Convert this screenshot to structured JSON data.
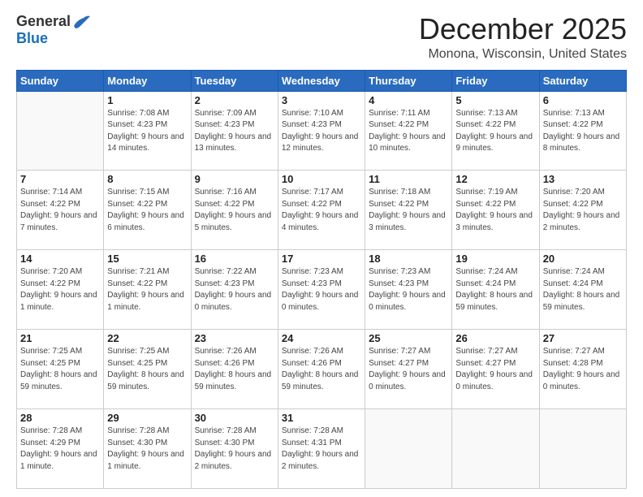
{
  "header": {
    "logo_general": "General",
    "logo_blue": "Blue",
    "title": "December 2025",
    "location": "Monona, Wisconsin, United States"
  },
  "days_of_week": [
    "Sunday",
    "Monday",
    "Tuesday",
    "Wednesday",
    "Thursday",
    "Friday",
    "Saturday"
  ],
  "weeks": [
    [
      {
        "day": "",
        "detail": ""
      },
      {
        "day": "1",
        "detail": "Sunrise: 7:08 AM\nSunset: 4:23 PM\nDaylight: 9 hours\nand 14 minutes."
      },
      {
        "day": "2",
        "detail": "Sunrise: 7:09 AM\nSunset: 4:23 PM\nDaylight: 9 hours\nand 13 minutes."
      },
      {
        "day": "3",
        "detail": "Sunrise: 7:10 AM\nSunset: 4:23 PM\nDaylight: 9 hours\nand 12 minutes."
      },
      {
        "day": "4",
        "detail": "Sunrise: 7:11 AM\nSunset: 4:22 PM\nDaylight: 9 hours\nand 10 minutes."
      },
      {
        "day": "5",
        "detail": "Sunrise: 7:13 AM\nSunset: 4:22 PM\nDaylight: 9 hours\nand 9 minutes."
      },
      {
        "day": "6",
        "detail": "Sunrise: 7:13 AM\nSunset: 4:22 PM\nDaylight: 9 hours\nand 8 minutes."
      }
    ],
    [
      {
        "day": "7",
        "detail": "Sunrise: 7:14 AM\nSunset: 4:22 PM\nDaylight: 9 hours\nand 7 minutes."
      },
      {
        "day": "8",
        "detail": "Sunrise: 7:15 AM\nSunset: 4:22 PM\nDaylight: 9 hours\nand 6 minutes."
      },
      {
        "day": "9",
        "detail": "Sunrise: 7:16 AM\nSunset: 4:22 PM\nDaylight: 9 hours\nand 5 minutes."
      },
      {
        "day": "10",
        "detail": "Sunrise: 7:17 AM\nSunset: 4:22 PM\nDaylight: 9 hours\nand 4 minutes."
      },
      {
        "day": "11",
        "detail": "Sunrise: 7:18 AM\nSunset: 4:22 PM\nDaylight: 9 hours\nand 3 minutes."
      },
      {
        "day": "12",
        "detail": "Sunrise: 7:19 AM\nSunset: 4:22 PM\nDaylight: 9 hours\nand 3 minutes."
      },
      {
        "day": "13",
        "detail": "Sunrise: 7:20 AM\nSunset: 4:22 PM\nDaylight: 9 hours\nand 2 minutes."
      }
    ],
    [
      {
        "day": "14",
        "detail": "Sunrise: 7:20 AM\nSunset: 4:22 PM\nDaylight: 9 hours\nand 1 minute."
      },
      {
        "day": "15",
        "detail": "Sunrise: 7:21 AM\nSunset: 4:22 PM\nDaylight: 9 hours\nand 1 minute."
      },
      {
        "day": "16",
        "detail": "Sunrise: 7:22 AM\nSunset: 4:23 PM\nDaylight: 9 hours\nand 0 minutes."
      },
      {
        "day": "17",
        "detail": "Sunrise: 7:23 AM\nSunset: 4:23 PM\nDaylight: 9 hours\nand 0 minutes."
      },
      {
        "day": "18",
        "detail": "Sunrise: 7:23 AM\nSunset: 4:23 PM\nDaylight: 9 hours\nand 0 minutes."
      },
      {
        "day": "19",
        "detail": "Sunrise: 7:24 AM\nSunset: 4:24 PM\nDaylight: 8 hours\nand 59 minutes."
      },
      {
        "day": "20",
        "detail": "Sunrise: 7:24 AM\nSunset: 4:24 PM\nDaylight: 8 hours\nand 59 minutes."
      }
    ],
    [
      {
        "day": "21",
        "detail": "Sunrise: 7:25 AM\nSunset: 4:25 PM\nDaylight: 8 hours\nand 59 minutes."
      },
      {
        "day": "22",
        "detail": "Sunrise: 7:25 AM\nSunset: 4:25 PM\nDaylight: 8 hours\nand 59 minutes."
      },
      {
        "day": "23",
        "detail": "Sunrise: 7:26 AM\nSunset: 4:26 PM\nDaylight: 8 hours\nand 59 minutes."
      },
      {
        "day": "24",
        "detail": "Sunrise: 7:26 AM\nSunset: 4:26 PM\nDaylight: 8 hours\nand 59 minutes."
      },
      {
        "day": "25",
        "detail": "Sunrise: 7:27 AM\nSunset: 4:27 PM\nDaylight: 9 hours\nand 0 minutes."
      },
      {
        "day": "26",
        "detail": "Sunrise: 7:27 AM\nSunset: 4:27 PM\nDaylight: 9 hours\nand 0 minutes."
      },
      {
        "day": "27",
        "detail": "Sunrise: 7:27 AM\nSunset: 4:28 PM\nDaylight: 9 hours\nand 0 minutes."
      }
    ],
    [
      {
        "day": "28",
        "detail": "Sunrise: 7:28 AM\nSunset: 4:29 PM\nDaylight: 9 hours\nand 1 minute."
      },
      {
        "day": "29",
        "detail": "Sunrise: 7:28 AM\nSunset: 4:30 PM\nDaylight: 9 hours\nand 1 minute."
      },
      {
        "day": "30",
        "detail": "Sunrise: 7:28 AM\nSunset: 4:30 PM\nDaylight: 9 hours\nand 2 minutes."
      },
      {
        "day": "31",
        "detail": "Sunrise: 7:28 AM\nSunset: 4:31 PM\nDaylight: 9 hours\nand 2 minutes."
      },
      {
        "day": "",
        "detail": ""
      },
      {
        "day": "",
        "detail": ""
      },
      {
        "day": "",
        "detail": ""
      }
    ]
  ]
}
